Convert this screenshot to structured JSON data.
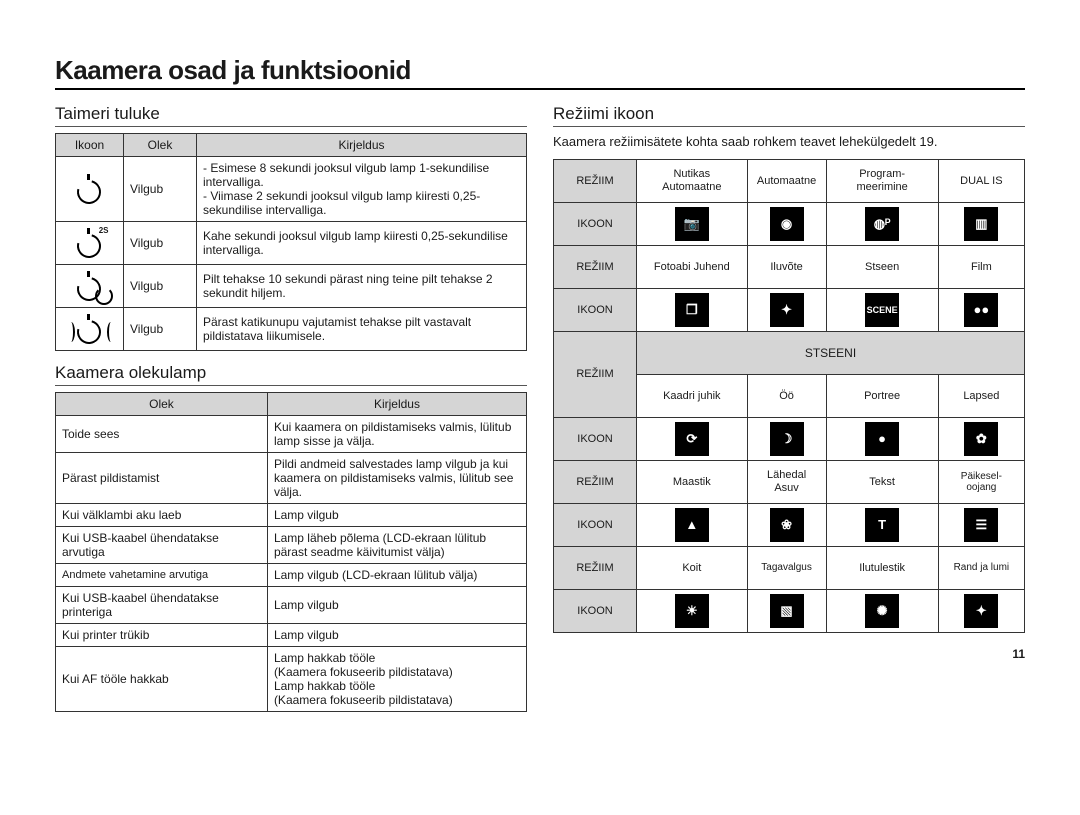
{
  "page": {
    "title": "Kaamera osad ja funktsioonid",
    "page_number": "11"
  },
  "timer": {
    "heading": "Taimeri tuluke",
    "headers": {
      "icon": "Ikoon",
      "status": "Olek",
      "desc": "Kirjeldus"
    },
    "rows": [
      {
        "icon_name": "timer-interval-icon",
        "status": "Vilgub",
        "desc": "- Esimese 8 sekundi jooksul vilgub lamp 1-sekundilise intervalliga.\n- Viimase 2 sekundi jooksul vilgub lamp kiiresti 0,25-sekundilise intervalliga."
      },
      {
        "icon_name": "timer-2s-icon",
        "status": "Vilgub",
        "desc": "Kahe sekundi jooksul vilgub lamp kiiresti 0,25-sekundilise intervalliga."
      },
      {
        "icon_name": "timer-double-icon",
        "status": "Vilgub",
        "desc": "Pilt tehakse 10 sekundi pärast ning teine pilt tehakse 2 sekundit hiljem."
      },
      {
        "icon_name": "timer-motion-icon",
        "status": "Vilgub",
        "desc": "Pärast katikunupu vajutamist tehakse pilt vastavalt pildistatava liikumisele."
      }
    ]
  },
  "status_lamp": {
    "heading": "Kaamera olekulamp",
    "headers": {
      "status": "Olek",
      "desc": "Kirjeldus"
    },
    "rows": [
      {
        "status": "Toide sees",
        "desc": "Kui kaamera on pildistamiseks valmis, lülitub lamp sisse ja välja."
      },
      {
        "status": "Pärast pildistamist",
        "desc": "Pildi andmeid salvestades lamp vilgub ja kui kaamera on pildistamiseks valmis, lülitub see välja."
      },
      {
        "status": "Kui välklambi aku laeb",
        "desc": "Lamp vilgub"
      },
      {
        "status": "Kui USB-kaabel ühendatakse arvutiga",
        "desc": "Lamp läheb põlema (LCD-ekraan lülitub pärast seadme käivitumist välja)"
      },
      {
        "status": "Andmete vahetamine arvutiga",
        "desc": "Lamp vilgub (LCD-ekraan lülitub välja)"
      },
      {
        "status": "Kui USB-kaabel ühendatakse printeriga",
        "desc": "Lamp vilgub"
      },
      {
        "status": "Kui printer trükib",
        "desc": "Lamp vilgub"
      },
      {
        "status": "Kui AF tööle hakkab",
        "desc": "Lamp hakkab tööle\n(Kaamera fokuseerib pildistatava)\nLamp hakkab tööle\n(Kaamera fokuseerib pildistatava)"
      }
    ]
  },
  "mode": {
    "heading": "Režiimi ikoon",
    "lead": "Kaamera režiimisätete kohta saab rohkem teavet lehekülgedelt 19.",
    "labels": {
      "mode": "REŽIIM",
      "icon": "IKOON",
      "scene": "STSEENI"
    },
    "rows": [
      {
        "names": [
          "Nutikas Automaatne",
          "Automaatne",
          "Program- meerimine",
          "DUAL IS"
        ],
        "icons": [
          "mode-smart-auto-icon",
          "mode-auto-icon",
          "mode-program-icon",
          "mode-dualis-icon"
        ],
        "glyph": [
          "📷",
          "◉",
          "◍ᴾ",
          "▥"
        ]
      },
      {
        "names": [
          "Fotoabi Juhend",
          "Iluvõte",
          "Stseen",
          "Film"
        ],
        "icons": [
          "mode-guide-icon",
          "mode-beauty-icon",
          "mode-scene-icon",
          "mode-movie-icon"
        ],
        "glyph": [
          "❐",
          "✦",
          "SCENE",
          "●●"
        ]
      }
    ],
    "scene_rows": [
      {
        "names": [
          "Kaadri juhik",
          "Öö",
          "Portree",
          "Lapsed"
        ],
        "icons": [
          "scene-frameguide-icon",
          "scene-night-icon",
          "scene-portrait-icon",
          "scene-children-icon"
        ],
        "glyph": [
          "⟳",
          "☽",
          "●",
          "✿"
        ]
      },
      {
        "names": [
          "Maastik",
          "Lähedal Asuv",
          "Tekst",
          "Päikesel- oojang"
        ],
        "icons": [
          "scene-landscape-icon",
          "scene-closeup-icon",
          "scene-text-icon",
          "scene-sunset-icon"
        ],
        "glyph": [
          "▲",
          "❀",
          "T",
          "☰"
        ]
      },
      {
        "names": [
          "Koit",
          "Tagavalgus",
          "Ilutulestik",
          "Rand ja lumi"
        ],
        "icons": [
          "scene-dawn-icon",
          "scene-backlight-icon",
          "scene-fireworks-icon",
          "scene-beachsnow-icon"
        ],
        "glyph": [
          "☀",
          "▧",
          "✺",
          "✦"
        ]
      }
    ]
  }
}
